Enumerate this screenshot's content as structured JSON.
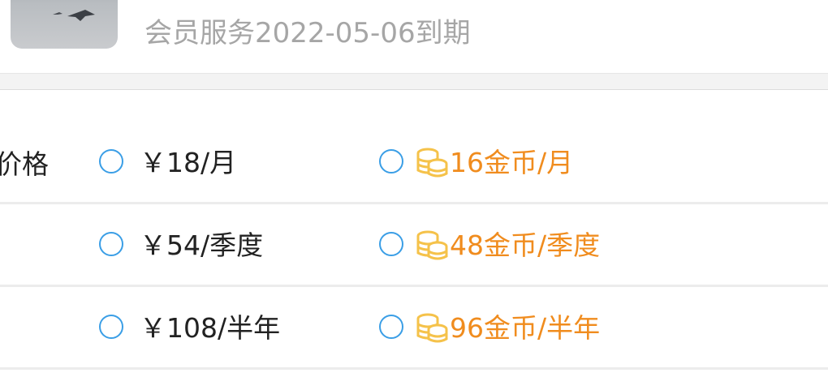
{
  "header": {
    "expire_text": "会员服务2022-05-06到期"
  },
  "price": {
    "label": "价格",
    "options": [
      {
        "rmb": "￥18/月",
        "coin": "16金币/月"
      },
      {
        "rmb": "￥54/季度",
        "coin": "48金币/季度"
      },
      {
        "rmb": "￥108/半年",
        "coin": "96金币/半年"
      }
    ]
  },
  "colors": {
    "radio_border": "#3a9ee6",
    "coin_text": "#f08c1e",
    "coin_icon": "#f5c24a"
  }
}
